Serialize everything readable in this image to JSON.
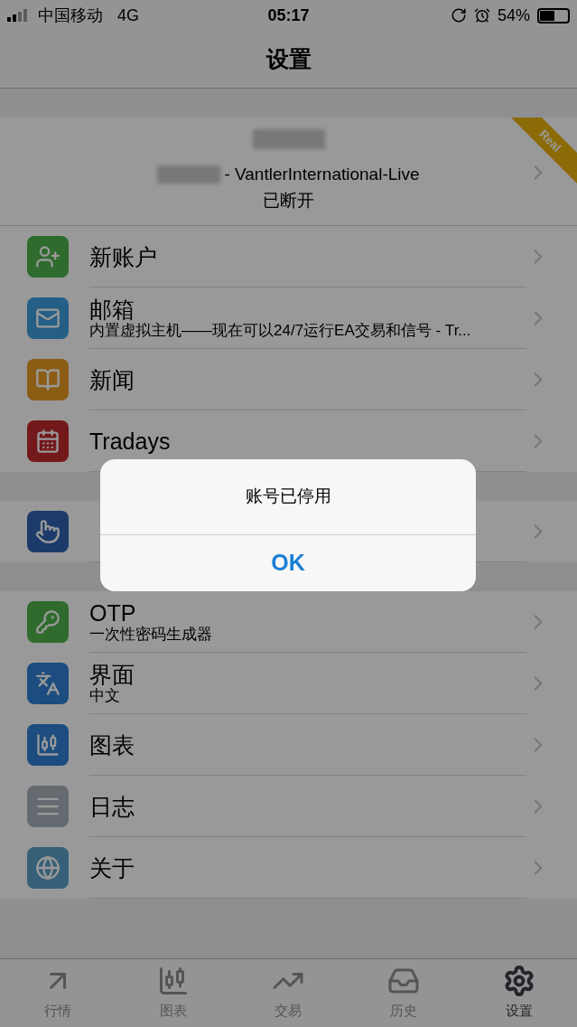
{
  "status_bar": {
    "carrier": "中国移动",
    "network": "4G",
    "time": "05:17",
    "battery": "54%"
  },
  "nav": {
    "title": "设置"
  },
  "account": {
    "server": "- VantlerInternational-Live",
    "status": "已断开",
    "badge": "Real"
  },
  "sections": [
    [
      {
        "title": "新账户",
        "color": "#2e6b2c"
      },
      {
        "title": "邮箱",
        "subtitle": "内置虚拟主机——现在可以24/7运行EA交易和信号 - Tr...",
        "color": "#255f86"
      },
      {
        "title": "新闻",
        "color": "#8b5c14"
      },
      {
        "title": "Tradays",
        "color": "#73181b"
      }
    ],
    [
      {
        "color": "#1c3b6a"
      }
    ],
    [
      {
        "title": "OTP",
        "subtitle": "一次性密码生成器",
        "color": "#2e6b2c"
      },
      {
        "title": "界面",
        "subtitle": "中文",
        "color": "#1c4c80"
      },
      {
        "title": "图表",
        "color": "#1c4c80"
      },
      {
        "title": "日志",
        "color": "#656a71"
      },
      {
        "title": "关于",
        "color": "#366078"
      }
    ]
  ],
  "alert": {
    "message": "账号已停用",
    "button": "OK"
  },
  "tabs": [
    {
      "label": "行情",
      "selected": false
    },
    {
      "label": "图表",
      "selected": false
    },
    {
      "label": "交易",
      "selected": false
    },
    {
      "label": "历史",
      "selected": false
    },
    {
      "label": "设置",
      "selected": true
    }
  ]
}
